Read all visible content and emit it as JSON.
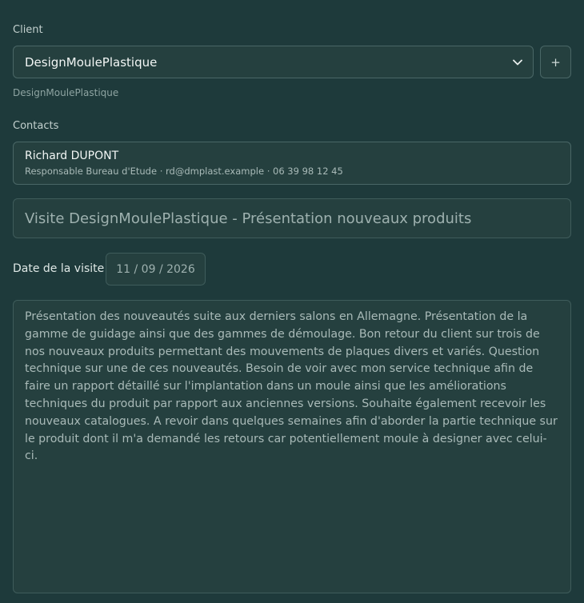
{
  "client": {
    "label": "Client",
    "selected": "DesignMoulePlastique",
    "add_label": "+",
    "hint": "DesignMoulePlastique"
  },
  "contacts": {
    "label": "Contacts",
    "items": [
      {
        "name": "Richard DUPONT",
        "details": "Responsable Bureau d'Etude · rd@dmplast.example · 06 39 98 12 45"
      }
    ]
  },
  "visit": {
    "title": "Visite DesignMoulePlastique - Présentation nouveaux produits",
    "date_label": "Date de la visite",
    "date_value": "11 / 09 / 2026",
    "notes": "Présentation des nouveautés suite aux derniers salons en Allemagne. Présentation de la gamme de guidage ainsi que des gammes de démoulage. Bon retour du client sur trois de nos nouveaux produits permettant des mouvements de plaques divers et variés. Question technique sur une de ces nouveautés. Besoin de voir avec mon service technique afin de faire un rapport détaillé sur l'implantation dans un moule ainsi que les améliorations techniques du produit par rapport aux anciennes versions. Souhaite également recevoir les nouveaux catalogues. A revoir dans quelques semaines afin d'aborder la partie technique sur le produit dont il m'a demandé les retours car potentiellement moule à designer avec celui-ci."
  },
  "icons": {
    "dropdown": "chevron-down-icon",
    "add": "plus-icon"
  }
}
